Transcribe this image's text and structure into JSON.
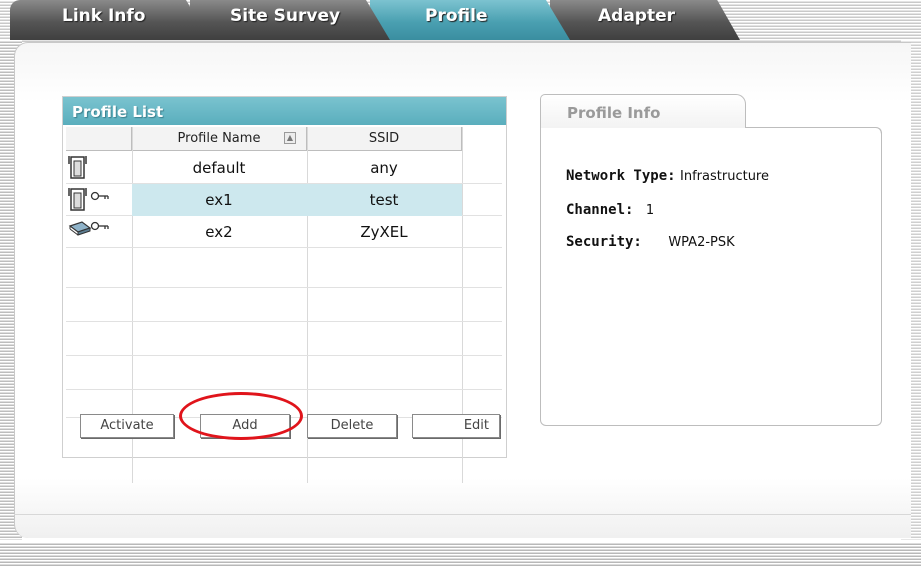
{
  "tabs": [
    {
      "label": "Link Info"
    },
    {
      "label": "Site Survey"
    },
    {
      "label": "Profile"
    },
    {
      "label": "Adapter"
    }
  ],
  "active_tab": "Profile",
  "profile_list": {
    "title": "Profile List",
    "columns": [
      "",
      "Profile Name",
      "SSID"
    ],
    "rows": [
      {
        "icon": "infrastructure-ap-icon",
        "name": "default",
        "ssid": "any",
        "selected": false
      },
      {
        "icon": "infrastructure-ap-secured-icon",
        "name": "ex1",
        "ssid": "test",
        "selected": true
      },
      {
        "icon": "adhoc-secured-icon",
        "name": "ex2",
        "ssid": "ZyXEL",
        "selected": false
      }
    ],
    "buttons": {
      "activate": "Activate",
      "add": "Add",
      "delete": "Delete",
      "edit": "Edit"
    }
  },
  "profile_info": {
    "title": "Profile Info",
    "network_type_label": "Network Type:",
    "network_type_value": "Infrastructure",
    "channel_label": "Channel:",
    "channel_value": "1",
    "security_label": "Security:",
    "security_value": "WPA2-PSK"
  },
  "colors": {
    "accent": "#5aaebd",
    "tab_inactive": "#555555",
    "selected_row": "#cde8ee",
    "highlight": "#e0141b"
  }
}
